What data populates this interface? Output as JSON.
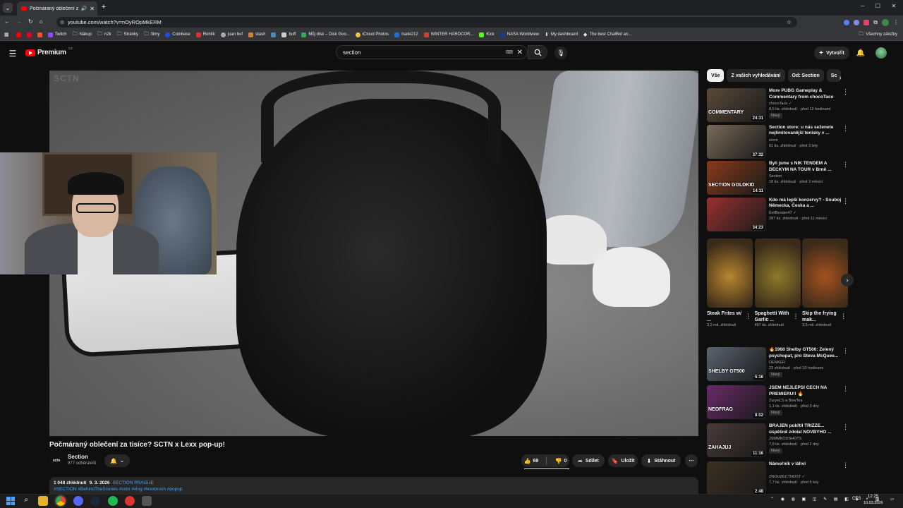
{
  "browser": {
    "tab_title": "Počmáraný oblečení za tisíce...",
    "url": "youtube.com/watch?v=nOyROpMkERM",
    "bookmarks": [
      "Twitch",
      "Nákup",
      "n2k",
      "Stránky",
      "filmy",
      "Coinbase",
      "Rohlík",
      "juan buf",
      "stash",
      "buff",
      "Můj disk – Disk Goo...",
      "iCloud Photos",
      "trade212",
      "WINTER HARDCOR...",
      "Kick",
      "NASA Worldview",
      "My dashboard",
      "The best ChatBot an..."
    ],
    "all_bookmarks": "Všechny záložky"
  },
  "youtube": {
    "logo": "Premium",
    "logo_sup": "CZ",
    "search_value": "section",
    "create_label": "Vytvořit"
  },
  "video": {
    "title": "Počmáraný oblečení za tisíce? SCTN x Lexx pop-up!",
    "channel": "Section",
    "channel_avatar": "sctn",
    "subscribers": "977 odběratelů",
    "likes": "69",
    "dislikes": "0",
    "share": "Sdílet",
    "save": "Uložit",
    "download": "Stáhnout",
    "views": "1 048 zhlédnutí",
    "date": "9. 3. 2026",
    "location": "SECTION PRAGUE",
    "hashtags": "#SECTION #BehindTheScenes #sctn #vlog #lexxbrush #popup",
    "watermark": "SCTN"
  },
  "sidebar": {
    "chips": [
      "Vše",
      "Z vašich vyhledávání",
      "Od: Section",
      "Sc"
    ],
    "recs_top": [
      {
        "title": "More PUBG Gameplay & Commentary from chocoTaco",
        "channel": "chocoTaco ✓",
        "meta": "8,5 tis. zhlédnutí · před 12 hodinami",
        "badge": "Nový",
        "duration": "24:31",
        "color": "#5a4a3a",
        "thumb_text": "COMMENTARY"
      },
      {
        "title": "Section store: u nás seženete nejlimitovanější tenisky v ...",
        "channel": "erem",
        "meta": "61 tis. zhlédnutí · před 3 lety",
        "badge": "",
        "duration": "37:32",
        "color": "#7a6a58",
        "thumb_text": ""
      },
      {
        "title": "Byli jsme s NIK TENDEM A DECKYM NA TOUR v Brně ...",
        "channel": "Section",
        "meta": "18 tis. zhlédnutí · před 3 měsíci",
        "badge": "",
        "duration": "14:11",
        "color": "#8a3a1a",
        "thumb_text": "SECTION GOLDKID"
      },
      {
        "title": "Kdo má lepší konzervy? - Souboj Německa, Česka a ...",
        "channel": "EvilBender47 ✓",
        "meta": "287 tis. zhlédnutí · před 11 měsíci",
        "badge": "",
        "duration": "34:23",
        "color": "#9a3030",
        "thumb_text": ""
      }
    ],
    "shorts": [
      {
        "title": "Steak Frites w/ ...",
        "meta": "3,2 mil. zhlédnutí",
        "color": "#b8862e"
      },
      {
        "title": "Spaghetti With Garlic ...",
        "meta": "497 tis. zhlédnutí",
        "color": "#8c7a2a"
      },
      {
        "title": "Skip the frying mak...",
        "meta": "3,5 mil. zhlédnutí",
        "color": "#a5521e"
      }
    ],
    "recs_bottom": [
      {
        "title": "🔥1968 Shelby GT500: Zelený psychopat, pro Steva McQuee...",
        "channel": "DENKER",
        "meta": "23 zhlédnutí · před 10 hodinami",
        "badge": "Nový",
        "duration": "5:16",
        "color": "#5a6470",
        "thumb_text": "SHELBY GT500"
      },
      {
        "title": "JSEM NEJLEPŠÍ ČECH NA PREMIERU!! 🔥",
        "channel": "ZuryeCS a BowTea",
        "meta": "1,1 tis. zhlédnutí · před 3 dny",
        "badge": "Nový",
        "duration": "8:02",
        "color": "#6a2a6a",
        "thumb_text": "NEOFRAG"
      },
      {
        "title": "BRAJEN pokřtil TRIZZE... úspěšně zdolal NOVBYHO ...",
        "channel": "JSMMKODSHOTS",
        "meta": "7,8 tis. zhlédnutí · před 2 dny",
        "badge": "Nový",
        "duration": "11:16",
        "color": "#4a3a3a",
        "thumb_text": "ZAHAJUJ"
      },
      {
        "title": "Námořník v láhvi",
        "channel": "ZNOUZECTNOST ✓",
        "meta": "7,7 tis. zhlédnutí · před 5 lety",
        "badge": "",
        "duration": "2:48",
        "color": "#3a3020",
        "thumb_text": ""
      }
    ]
  },
  "taskbar": {
    "lang": "CES",
    "time": "12:25",
    "date": "10.03.2026"
  }
}
